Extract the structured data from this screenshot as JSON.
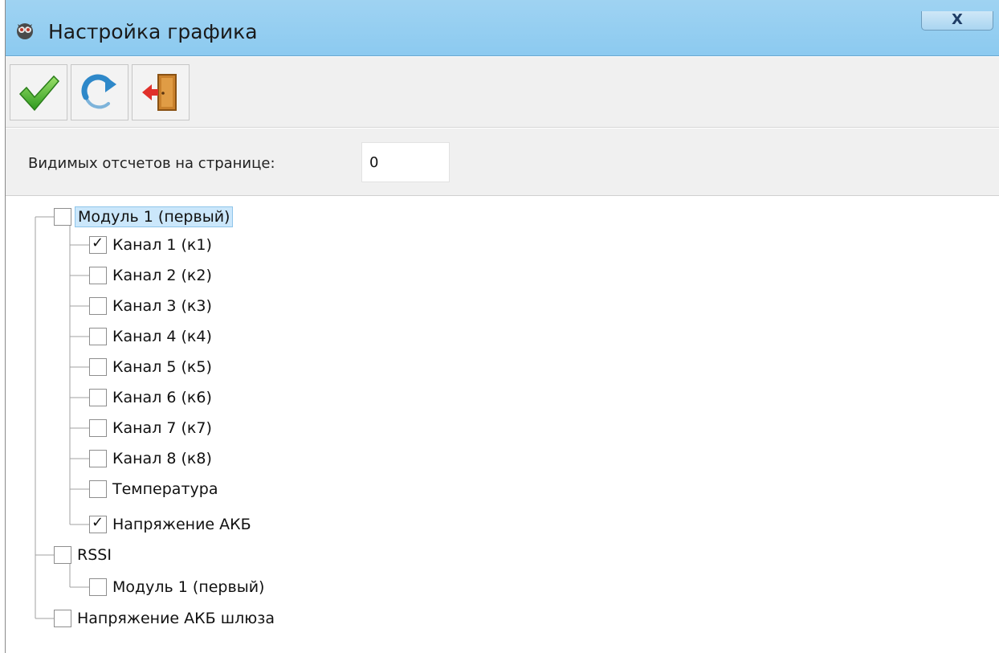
{
  "window": {
    "title": "Настройка графика",
    "close_label": "X"
  },
  "toolbar": {
    "buttons": [
      {
        "name": "apply",
        "icon": "checkmark-icon"
      },
      {
        "name": "refresh",
        "icon": "refresh-icon"
      },
      {
        "name": "exit",
        "icon": "exit-door-icon"
      }
    ]
  },
  "params": {
    "samples_label": "Видимых отсчетов на странице:",
    "samples_value": "0"
  },
  "tree": {
    "module1": {
      "label": "Модуль 1 (первый)",
      "checked": false,
      "selected": true
    },
    "channels": [
      {
        "label": "Канал 1 (к1)",
        "checked": true
      },
      {
        "label": "Канал 2 (к2)",
        "checked": false
      },
      {
        "label": "Канал 3 (к3)",
        "checked": false
      },
      {
        "label": "Канал 4 (к4)",
        "checked": false
      },
      {
        "label": "Канал 5 (к5)",
        "checked": false
      },
      {
        "label": "Канал 6 (к6)",
        "checked": false
      },
      {
        "label": "Канал 7 (к7)",
        "checked": false
      },
      {
        "label": "Канал 8 (к8)",
        "checked": false
      },
      {
        "label": "Температура",
        "checked": false
      },
      {
        "label": "Напряжение АКБ",
        "checked": true
      }
    ],
    "rssi": {
      "label": "RSSI",
      "checked": false
    },
    "rssi_module": {
      "label": "Модуль 1 (первый)",
      "checked": false
    },
    "gateway_battery": {
      "label": "Напряжение АКБ шлюза",
      "checked": false
    },
    "check_mark": "✓"
  },
  "colors": {
    "titlebar": "#9fd3f2",
    "selection": "#cbe7fb",
    "tree_lines": "#a0a0a0"
  }
}
